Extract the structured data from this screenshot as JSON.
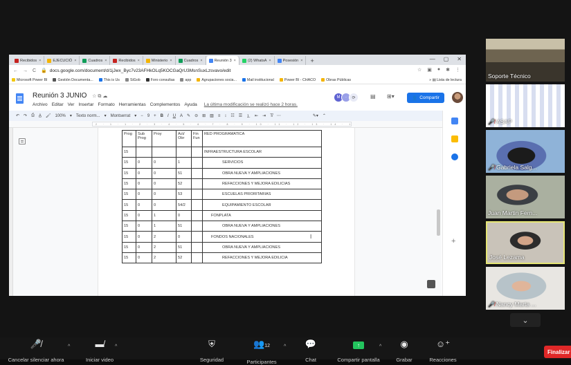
{
  "browser": {
    "tabs": [
      {
        "label": "Recibidos",
        "color": "#c5221f"
      },
      {
        "label": "EJECUCIÓ",
        "color": "#f4b400"
      },
      {
        "label": "Cuadros",
        "color": "#0f9d58"
      },
      {
        "label": "Recibidos",
        "color": "#c5221f"
      },
      {
        "label": "Ministerio",
        "color": "#f4b400"
      },
      {
        "label": "Cuadros",
        "color": "#0f9d58"
      },
      {
        "label": "Reunión 3",
        "color": "#4285f4"
      },
      {
        "label": "(2) WhatsA",
        "color": "#25d366"
      },
      {
        "label": "Posesión",
        "color": "#4285f4"
      }
    ],
    "new_tab": "+",
    "url": "docs.google.com/document/d/1jJwx_Byc7v23AFHkOLq5KOCGaQrU3MsnSuxLzsvavo/edit",
    "bookmarks": [
      {
        "label": "Microsoft Power BI",
        "color": "#f2c811"
      },
      {
        "label": "Gestión Documenta...",
        "color": "#555555"
      },
      {
        "label": "This is Us",
        "color": "#1a73e8"
      },
      {
        "label": "SiGob",
        "color": "#888888"
      },
      {
        "label": "Foro consultas",
        "color": "#333333"
      },
      {
        "label": "app",
        "color": "#888888"
      },
      {
        "label": "Agrupaciones socia...",
        "color": "#f4b400"
      },
      {
        "label": "Mail institucional",
        "color": "#1a73e8"
      },
      {
        "label": "Power BI - CHACO",
        "color": "#f4b400"
      },
      {
        "label": "Obras Públicas",
        "color": "#f4b400"
      }
    ],
    "reading_list": "Lista de lectura"
  },
  "doc": {
    "title": "Reunión 3 JUNIO",
    "menus": [
      "Archivo",
      "Editar",
      "Ver",
      "Insertar",
      "Formato",
      "Herramientas",
      "Complementos",
      "Ayuda"
    ],
    "last_edit": "La última modificación se realizó hace 2 horas.",
    "share_label": "Compartir",
    "toolbar": {
      "zoom": "100%",
      "style": "Texto norm...",
      "font": "Montserrat",
      "font_size": "9"
    },
    "ruler_marks": "2 · 1 · 1 · 2 · 3 · 4 · 5 · 6 · 7 · 8 · 9 · 10 · 11 · 12 · 13 · 14 · 15 · 16 · 17 · 18",
    "table": {
      "headers": [
        "Prog",
        "Sub Prog",
        "Proy",
        "Act/ Obr",
        "Fin Fun",
        "RED PROGRAMATICA"
      ],
      "rows": [
        {
          "cells": [
            "15",
            "",
            "",
            "",
            "",
            "INFRAESTRUCTURA ESCOLAR"
          ],
          "level": 0
        },
        {
          "cells": [
            "15",
            "0",
            "0",
            "1",
            "",
            "SERVICIOS"
          ],
          "level": 2
        },
        {
          "cells": [
            "15",
            "0",
            "0",
            "51",
            "",
            "OBRA NUEVA Y AMPLIACIONES"
          ],
          "level": 2
        },
        {
          "cells": [
            "15",
            "0",
            "0",
            "52",
            "",
            "REFACCIONES Y MEJORA EDILICIAS"
          ],
          "level": 2
        },
        {
          "cells": [
            "15",
            "0",
            "0",
            "53",
            "",
            "ESCUELAS PRIORITARIAS"
          ],
          "level": 2
        },
        {
          "cells": [
            "15",
            "0",
            "0",
            "54/2",
            "",
            "EQUIPAMIENTO ESCOLAR"
          ],
          "level": 2
        },
        {
          "cells": [
            "15",
            "0",
            "1",
            "0",
            "",
            "FONPLATA"
          ],
          "level": 1
        },
        {
          "cells": [
            "15",
            "0",
            "1",
            "51",
            "",
            "OBRA NUEVA Y AMPLIACIONES"
          ],
          "level": 2
        },
        {
          "cells": [
            "15",
            "0",
            "2",
            "0",
            "",
            "FONDOS NACIONALES"
          ],
          "level": 1
        },
        {
          "cells": [
            "15",
            "0",
            "2",
            "51",
            "",
            "OBRA NUEVA Y AMPLIACIONES"
          ],
          "level": 2
        },
        {
          "cells": [
            "15",
            "0",
            "2",
            "52",
            "",
            "REFACCIONES Y MEJORA EDILICIA"
          ],
          "level": 2
        }
      ]
    }
  },
  "participants": [
    {
      "name": "Soporte Técnico",
      "muted": false
    },
    {
      "name": "ASAP",
      "muted": true
    },
    {
      "name": "Gabriela Salg...",
      "muted": true
    },
    {
      "name": "Juan Martin Fern...",
      "muted": false
    },
    {
      "name": "José Lezama",
      "muted": false,
      "speaking": true
    },
    {
      "name": "Nancy Marta ...",
      "muted": true
    }
  ],
  "zoom_bar": {
    "mute_label": "Cancelar silenciar ahora",
    "video_label": "Iniciar video",
    "security_label": "Seguridad",
    "participants_label": "Participantes",
    "participants_count": "12",
    "chat_label": "Chat",
    "share_label": "Compartir pantalla",
    "record_label": "Grabar",
    "reactions_label": "Reacciones",
    "end_label": "Finalizar"
  },
  "colors": {
    "share_button": "#1a73e8",
    "share_screen_green": "#23c45e",
    "end_red": "#e02828",
    "speaker_border": "#e6e675"
  }
}
